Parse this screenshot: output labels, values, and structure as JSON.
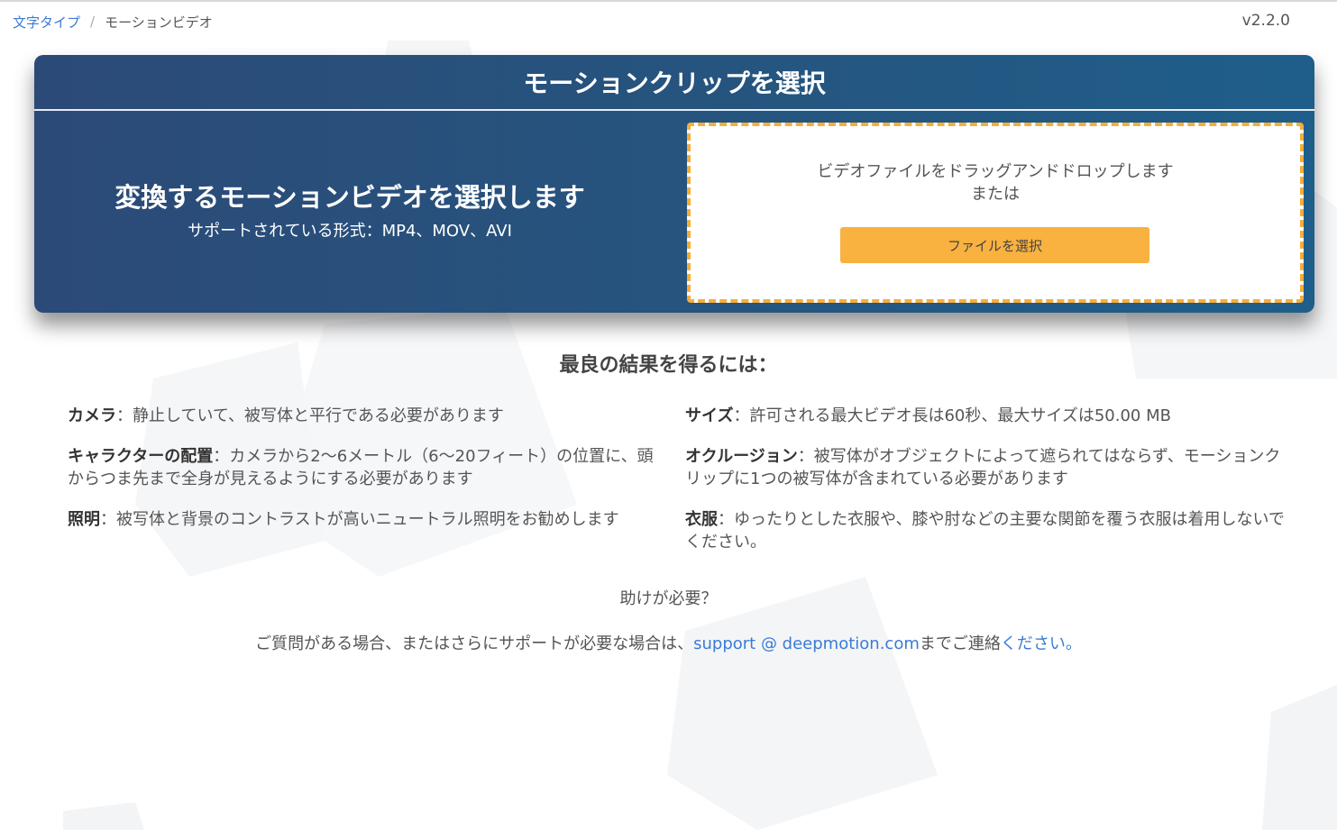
{
  "breadcrumb": {
    "parent": "文字タイプ",
    "separator": "/",
    "current": "モーションビデオ"
  },
  "version": "v2.2.0",
  "panel": {
    "title": "モーションクリップを選択",
    "heading": "変換するモーションビデオを選択します",
    "formats": "サポートされている形式：MP4、MOV、AVI"
  },
  "dropzone": {
    "line1": "ビデオファイルをドラッグアンドドロップします",
    "line2": "または",
    "button_label": "ファイルを選択"
  },
  "tips": {
    "title": "最良の結果を得るには：",
    "camera": {
      "label": "カメラ",
      "text": "：静止していて、被写体と平行である必要があります"
    },
    "position": {
      "label": "キャラクターの配置",
      "text": "：カメラから2～6メートル（6～20フィート）の位置に、頭からつま先まで全身が見えるようにする必要があります"
    },
    "lighting": {
      "label": "照明",
      "text": "：被写体と背景のコントラストが高いニュートラル照明をお勧めします"
    },
    "size": {
      "label": "サイズ",
      "text": "：許可される最大ビデオ長は60秒、最大サイズは50.00 MB"
    },
    "occlusion": {
      "label": "オクルージョン",
      "text": "：被写体がオブジェクトによって遮られてはならず、モーションクリップに1つの被写体が含まれている必要があります"
    },
    "clothing": {
      "label": "衣服",
      "text": "：ゆったりとした衣服や、膝や肘などの主要な関節を覆う衣服は着用しないでください。"
    }
  },
  "help": {
    "title": "助けが必要？",
    "text_before": "ご質問がある場合、またはさらにサポートが必要な場合は、",
    "email": "support @ deepmotion.com",
    "text_middle": "までご連絡",
    "text_after": "ください。"
  },
  "colors": {
    "panel_start": "#2c4a77",
    "panel_end": "#1f5e8a",
    "accent_orange": "#f9b13f",
    "link_blue": "#3a7bd5"
  }
}
